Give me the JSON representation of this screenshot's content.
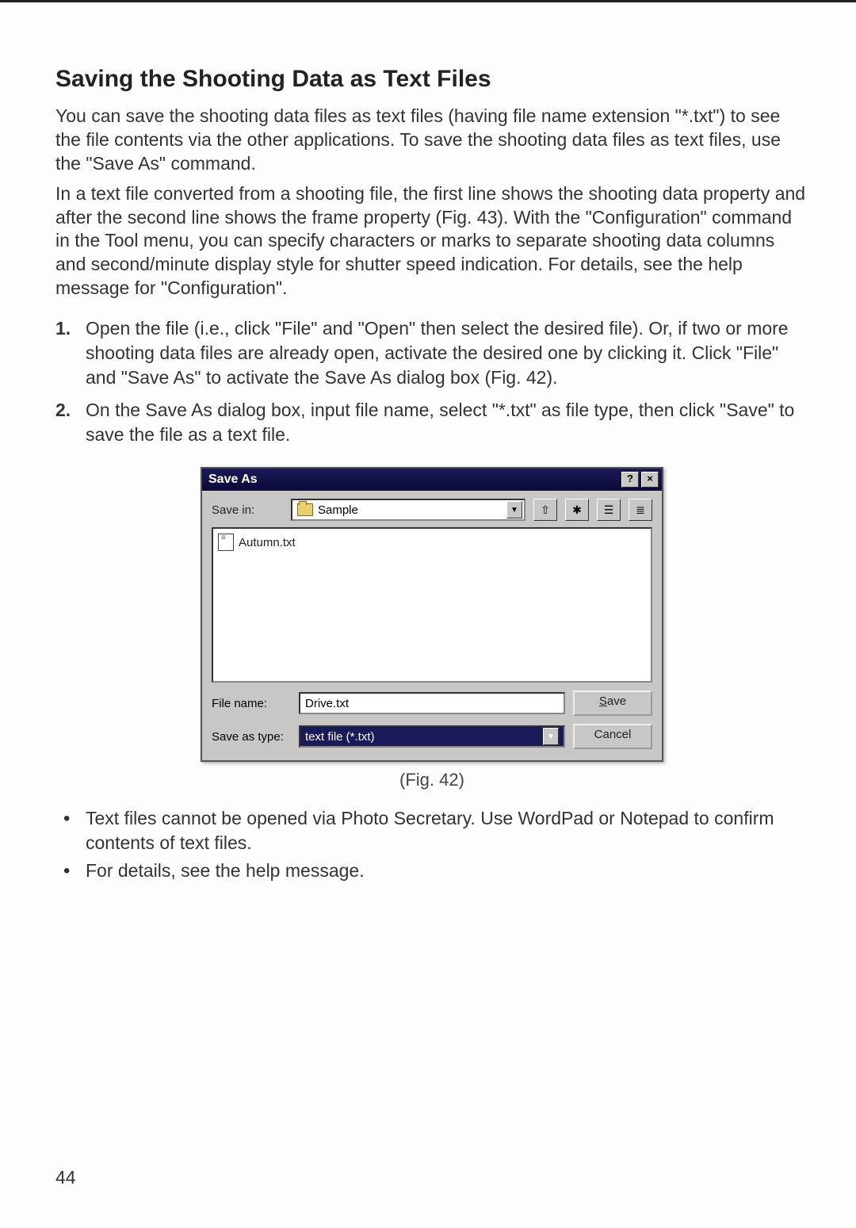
{
  "heading": "Saving the Shooting Data as Text Files",
  "para1": "You can save the shooting data files as text files (having file name extension \"*.txt\") to see the file contents via the other applications. To save the shooting data files as text files, use the \"Save As\" command.",
  "para2": "In a text file converted from a shooting file, the first line shows the shooting data property and after the second line shows the frame property (Fig. 43). With the \"Configuration\" command in the Tool menu, you can specify characters or marks to separate shooting data columns and second/minute display style for shutter speed indication. For details, see the help message for \"Configuration\".",
  "steps": [
    {
      "num": "1.",
      "text": "Open the file (i.e., click \"File\" and \"Open\" then select the desired file). Or, if two or more shooting data files are already open, activate the desired one by clicking it. Click \"File\" and \"Save As\" to activate the Save As dialog box (Fig. 42)."
    },
    {
      "num": "2.",
      "text": "On the Save As dialog box, input file name, select \"*.txt\" as file type, then click \"Save\" to save the file as a text file."
    }
  ],
  "dialog": {
    "title": "Save As",
    "help_glyph": "?",
    "close_glyph": "×",
    "save_in_label": "Save in:",
    "save_in_folder": "Sample",
    "nav_icons": {
      "up": "⇧",
      "new": "✱",
      "list": "☰",
      "details": "≣"
    },
    "file_list": [
      "Autumn.txt"
    ],
    "file_name_label": "File name:",
    "file_name_value": "Drive.txt",
    "save_as_type_label": "Save as type:",
    "save_as_type_value": "text file (*.txt)",
    "save_button": "Save",
    "cancel_button": "Cancel",
    "dd_arrow": "▼"
  },
  "figure_caption": "(Fig. 42)",
  "bullets": [
    "Text files cannot be opened via Photo Secretary. Use WordPad or Notepad to confirm contents of text files.",
    "For details, see the help message."
  ],
  "page_number": "44"
}
